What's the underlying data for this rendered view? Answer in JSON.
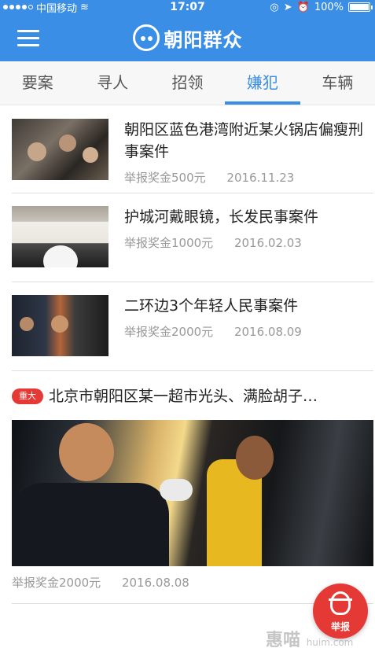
{
  "status_bar": {
    "carrier": "中国移动",
    "time": "17:07",
    "battery": "100%",
    "battery_level": 1.0
  },
  "header": {
    "app_name": "朝阳群众",
    "logo_icon": "face-logo-icon",
    "menu_icon": "hamburger-menu-icon"
  },
  "tabs": [
    {
      "label": "要案",
      "active": false
    },
    {
      "label": "寻人",
      "active": false
    },
    {
      "label": "招领",
      "active": false
    },
    {
      "label": "嫌犯",
      "active": true
    },
    {
      "label": "车辆",
      "active": false
    }
  ],
  "items": [
    {
      "title": "朝阳区蓝色港湾附近某火锅店偏瘦刑事案件",
      "reward": "举报奖金500元",
      "date": "2016.11.23"
    },
    {
      "title": "护城河戴眼镜，长发民事案件",
      "reward": "举报奖金1000元",
      "date": "2016.02.03"
    },
    {
      "title": "二环边3个年轻人民事案件",
      "reward": "举报奖金2000元",
      "date": "2016.08.09"
    }
  ],
  "featured": {
    "badge": "重大",
    "title": "北京市朝阳区某一超市光头、满脸胡子…",
    "reward": "举报奖金2000元",
    "date": "2016.08.08"
  },
  "fab": {
    "label": "举报",
    "icon": "detective-icon"
  },
  "watermark": {
    "text": "惠喵",
    "sub": "huim.com"
  },
  "colors": {
    "accent": "#3a8ee6",
    "alert": "#e53935"
  }
}
